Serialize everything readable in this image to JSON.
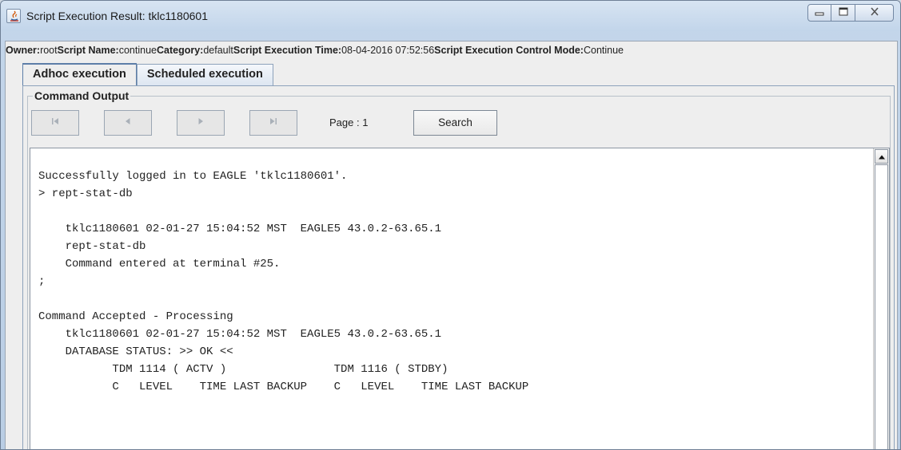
{
  "window": {
    "title": "Script Execution Result: tklc1180601",
    "controls": [
      "minimize-icon",
      "maximize-icon",
      "close-icon"
    ]
  },
  "info": {
    "owner_label": "Owner:",
    "owner_value": "root",
    "script_name_label": "Script Name:",
    "script_name_value": "continue",
    "category_label": "Category:",
    "category_value": "default",
    "exec_time_label": "Script Execution Time:",
    "exec_time_value": "08-04-2016 07:52:56",
    "control_mode_label": "Script Execution Control Mode:",
    "control_mode_value": "Continue"
  },
  "tabs": [
    {
      "label": "Adhoc execution",
      "active": true
    },
    {
      "label": "Scheduled execution",
      "active": false
    }
  ],
  "command_output": {
    "group_title": "Command Output",
    "nav_icons": [
      "first-page-icon",
      "previous-page-icon",
      "next-page-icon",
      "last-page-icon"
    ],
    "page_label": "Page :  1",
    "search_label": "Search",
    "text": "Successfully logged in to EAGLE 'tklc1180601'.\n> rept-stat-db\n\n    tklc1180601 02-01-27 15:04:52 MST  EAGLE5 43.0.2-63.65.1\n    rept-stat-db\n    Command entered at terminal #25.\n;\n\nCommand Accepted - Processing\n    tklc1180601 02-01-27 15:04:52 MST  EAGLE5 43.0.2-63.65.1\n    DATABASE STATUS: >> OK <<\n           TDM 1114 ( ACTV )                TDM 1116 ( STDBY)\n           C   LEVEL    TIME LAST BACKUP    C   LEVEL    TIME LAST BACKUP"
  },
  "colors": {
    "titlebar": "#c2d5ea",
    "content_bg": "#eeeeee",
    "tab_border": "#5d7ea8"
  }
}
